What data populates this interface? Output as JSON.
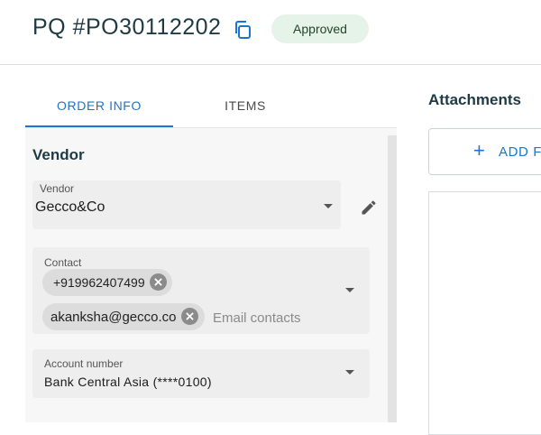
{
  "header": {
    "title": "PQ #PO30112202",
    "status": "Approved"
  },
  "tabs": [
    {
      "label": "ORDER INFO",
      "active": true
    },
    {
      "label": "ITEMS",
      "active": false
    }
  ],
  "vendor_section": {
    "heading": "Vendor",
    "vendor": {
      "label": "Vendor",
      "value": "Gecco&Co"
    },
    "contact": {
      "label": "Contact",
      "chips": [
        "+919962407499",
        "akanksha@gecco.co"
      ],
      "placeholder": "Email contacts"
    },
    "account": {
      "label": "Account number",
      "value": "Bank Central Asia (****0100)"
    }
  },
  "attachments": {
    "heading": "Attachments",
    "add_button_label": "ADD FI",
    "add_icon": "+"
  },
  "colors": {
    "accent": "#1976d2",
    "badge_bg": "#e6f3e8",
    "heading": "#1e3a44"
  }
}
